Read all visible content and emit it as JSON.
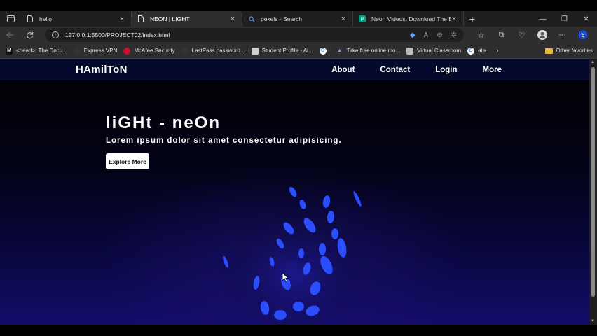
{
  "browser": {
    "tabs": [
      {
        "title": "hello",
        "icon": "page-icon",
        "active": false
      },
      {
        "title": "NEON | LIGHT",
        "icon": "page-icon",
        "active": true
      },
      {
        "title": "pexels - Search",
        "icon": "search-icon",
        "active": false
      },
      {
        "title": "Neon Videos, Download The BEST",
        "icon": "pexels-icon",
        "active": false
      }
    ],
    "new_tab": "+",
    "window_controls": {
      "minimize": "—",
      "restore": "❐",
      "close": "✕"
    },
    "url": "127.0.0.1:5500/PROJECT02/index.html",
    "bookmarks": [
      {
        "label": "<head>: The Docu...",
        "icon_text": "M",
        "icon_color": "#ffffff"
      },
      {
        "label": "Express VPN",
        "icon_text": "",
        "icon_color": "#da3940"
      },
      {
        "label": "McAfee Security",
        "icon_text": "",
        "icon_color": "#c8102e"
      },
      {
        "label": "LastPass password...",
        "icon_text": "",
        "icon_color": "#cc2229"
      },
      {
        "label": "Student Profile - Al...",
        "icon_text": "",
        "icon_color": "#cfcfcf"
      },
      {
        "label": "",
        "icon_text": "G",
        "icon_color": "#4285f4"
      },
      {
        "label": "Take free online mo...",
        "icon_text": "",
        "icon_color": "#5a6ad6"
      },
      {
        "label": "Virtual Classroom",
        "icon_text": "",
        "icon_color": "#bdbdbd"
      },
      {
        "label": "ate",
        "icon_text": "G",
        "icon_color": "#4285f4"
      }
    ],
    "other_favorites": "Other favorites"
  },
  "site": {
    "brand": "HAmilToN",
    "nav": [
      "About",
      "Contact",
      "Login",
      "More"
    ],
    "hero": {
      "title": "liGHt - neOn",
      "subtitle": "Lorem ipsum dolor sit amet consectetur adipisicing.",
      "cta": "Explore More"
    }
  }
}
